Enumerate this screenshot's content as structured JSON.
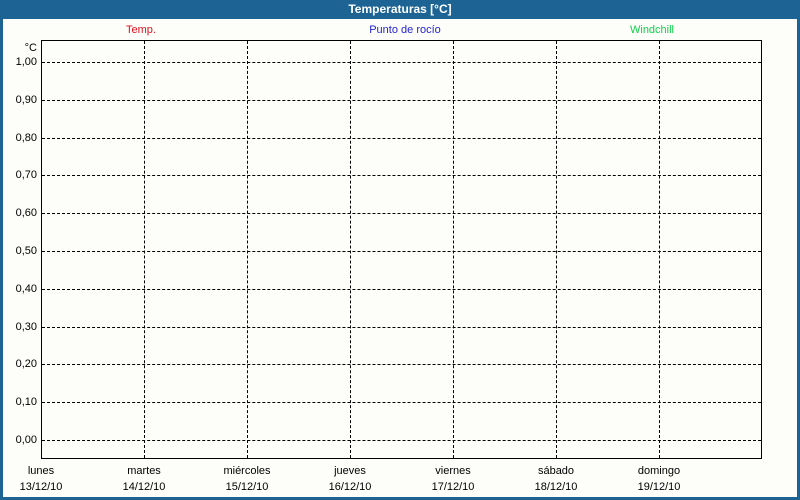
{
  "window": {
    "title": "Temperaturas [°C]"
  },
  "colors": {
    "frame_blue": "#1d6495",
    "background": "#fdfdfa",
    "grid_black": "#000000",
    "temp_red": "#e0101e",
    "dewpoint_blue": "#2323cc",
    "windchill_green": "#0fd149"
  },
  "legend": {
    "items": [
      {
        "label": "Temp.",
        "color": "#e0101e"
      },
      {
        "label": "Punto de rocío",
        "color": "#2323cc"
      },
      {
        "label": "Windchill",
        "color": "#0fd149"
      }
    ]
  },
  "y_axis": {
    "unit_label": "°C",
    "tick_labels": [
      "1,00",
      "0,90",
      "0,80",
      "0,70",
      "0,60",
      "0,50",
      "0,40",
      "0,30",
      "0,20",
      "0,10",
      "0,00"
    ]
  },
  "x_axis": {
    "days": [
      {
        "name": "lunes",
        "date": "13/12/10"
      },
      {
        "name": "martes",
        "date": "14/12/10"
      },
      {
        "name": "miércoles",
        "date": "15/12/10"
      },
      {
        "name": "jueves",
        "date": "16/12/10"
      },
      {
        "name": "viernes",
        "date": "17/12/10"
      },
      {
        "name": "sábado",
        "date": "18/12/10"
      },
      {
        "name": "domingo",
        "date": "19/12/10"
      }
    ]
  },
  "chart_data": {
    "type": "line",
    "title": "Temperaturas [°C]",
    "xlabel": "",
    "ylabel": "°C",
    "ylim": [
      0.0,
      1.0
    ],
    "ytick_interval": 0.1,
    "ytick_labels": [
      "1,00",
      "0,90",
      "0,80",
      "0,70",
      "0,60",
      "0,50",
      "0,40",
      "0,30",
      "0,20",
      "0,10",
      "0,00"
    ],
    "x": [
      "lunes 13/12/10",
      "martes 14/12/10",
      "miércoles 15/12/10",
      "jueves 16/12/10",
      "viernes 17/12/10",
      "sábado 18/12/10",
      "domingo 19/12/10"
    ],
    "series": [
      {
        "name": "Temp.",
        "color": "#e0101e",
        "values": []
      },
      {
        "name": "Punto de rocío",
        "color": "#2323cc",
        "values": []
      },
      {
        "name": "Windchill",
        "color": "#0fd149",
        "values": []
      }
    ],
    "grid": "dashed",
    "legend_position": "top"
  }
}
